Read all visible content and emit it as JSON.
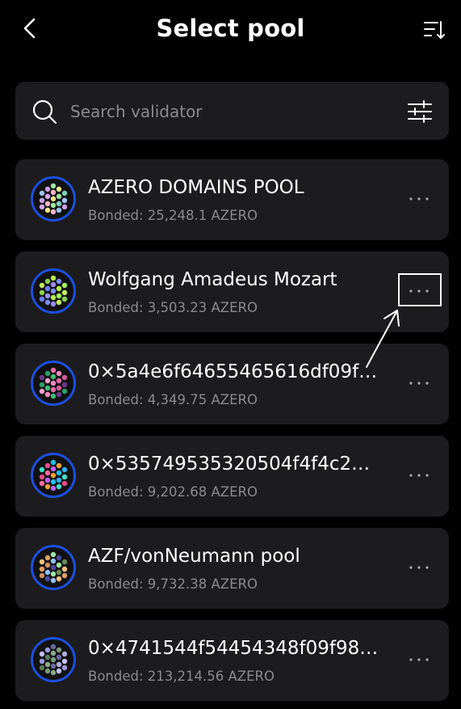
{
  "header": {
    "title": "Select pool",
    "back_icon": "chevron-left-icon",
    "sort_icon": "sort-descending-icon"
  },
  "search": {
    "placeholder": "Search validator",
    "value": "",
    "filter_icon": "sliders-icon"
  },
  "pools": [
    {
      "name": "AZERO DOMAINS POOL",
      "bonded_label": "Bonded:",
      "bonded_value": "25,248.1 AZERO"
    },
    {
      "name": "Wolfgang Amadeus Mozart",
      "bonded_label": "Bonded:",
      "bonded_value": "3,503.23 AZERO"
    },
    {
      "name": "0×5a4e6f64655465616df09f…",
      "bonded_label": "Bonded:",
      "bonded_value": "4,349.75 AZERO"
    },
    {
      "name": "0×535749535320504f4f4c2…",
      "bonded_label": "Bonded:",
      "bonded_value": "9,202.68 AZERO"
    },
    {
      "name": "AZF/vonNeumann pool",
      "bonded_label": "Bonded:",
      "bonded_value": "9,732.38 AZERO"
    },
    {
      "name": "0×4741544f54454348f09f98…",
      "bonded_label": "Bonded:",
      "bonded_value": "213,214.56 AZERO"
    }
  ],
  "colors": {
    "background": "#000000",
    "card": "#1c1c1e",
    "muted_text": "#8a8a8f",
    "avatar_ring": "#1d4fe0"
  }
}
